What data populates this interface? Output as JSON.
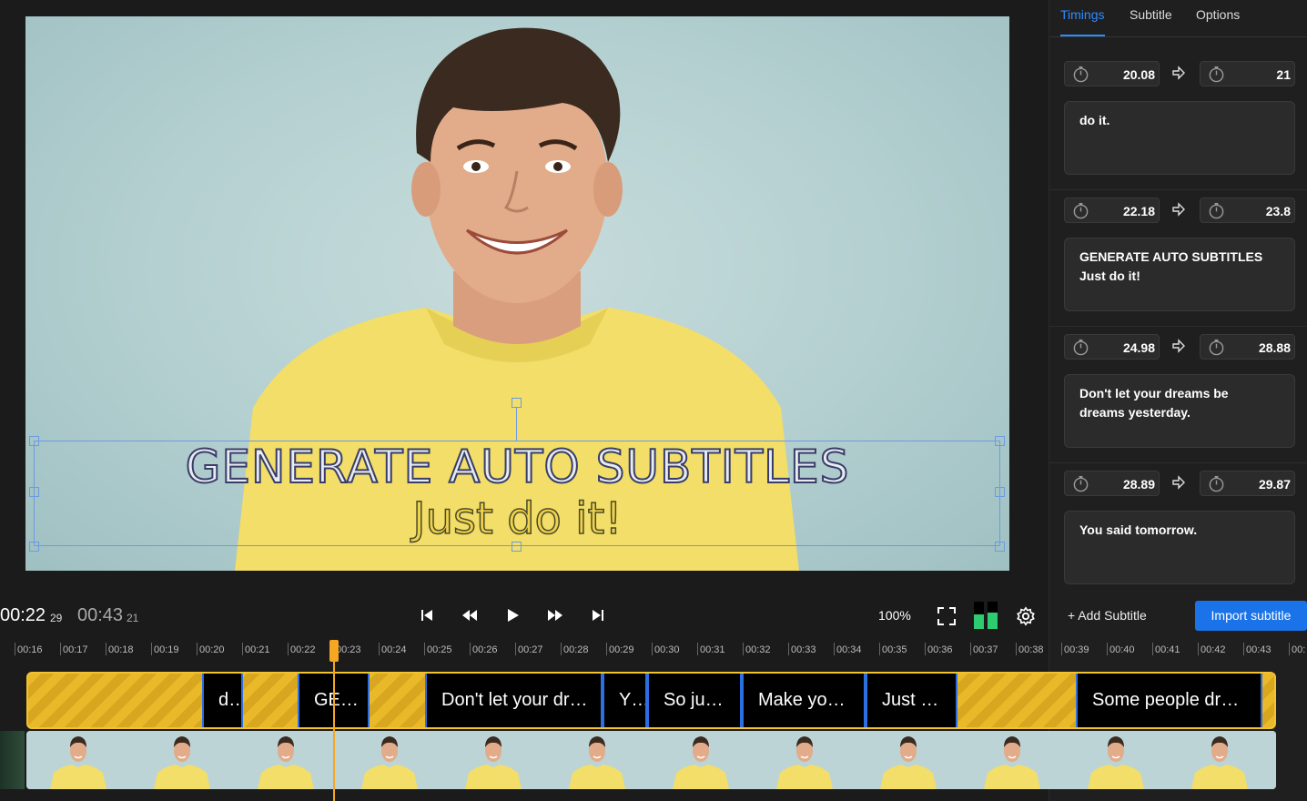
{
  "preview": {
    "subtitle_line1": "GENERATE AUTO SUBTITLES",
    "subtitle_line2": "Just do it!"
  },
  "panel": {
    "tabs": [
      "Timings",
      "Subtitle",
      "Options"
    ],
    "active_tab": "Timings",
    "entries": [
      {
        "start": "20.08",
        "end": "21",
        "text": "do it."
      },
      {
        "start": "22.18",
        "end": "23.8",
        "text": "GENERATE AUTO SUBTITLES\nJust do it!"
      },
      {
        "start": "24.98",
        "end": "28.88",
        "text": "Don't let your dreams be\ndreams yesterday."
      },
      {
        "start": "28.89",
        "end": "29.87",
        "text": "You said tomorrow."
      }
    ],
    "add_subtitle_label": "+ Add Subtitle",
    "import_label": "Import subtitle"
  },
  "controls": {
    "current_time": "00:22",
    "current_frame": "29",
    "total_time": "00:43",
    "total_frame": "21",
    "zoom": "100%"
  },
  "ruler": [
    "00:16",
    "00:17",
    "00:18",
    "00:19",
    "00:20",
    "00:21",
    "00:22",
    "00:23",
    "00:24",
    "00:25",
    "00:26",
    "00:27",
    "00:28",
    "00:29",
    "00:30",
    "00:31",
    "00:32",
    "00:33",
    "00:34",
    "00:35",
    "00:36",
    "00:37",
    "00:38",
    "00:39",
    "00:40",
    "00:41",
    "00:42",
    "00:43",
    "00:"
  ],
  "clips": [
    "d…",
    "GE…",
    "Don't let your dr…",
    "Y…",
    "So ju…",
    "Make yo…",
    "Just …",
    "Some people dr…"
  ],
  "colors": {
    "accent": "#1a73e8",
    "track": "#f2c230",
    "playhead": "#f5a623"
  }
}
